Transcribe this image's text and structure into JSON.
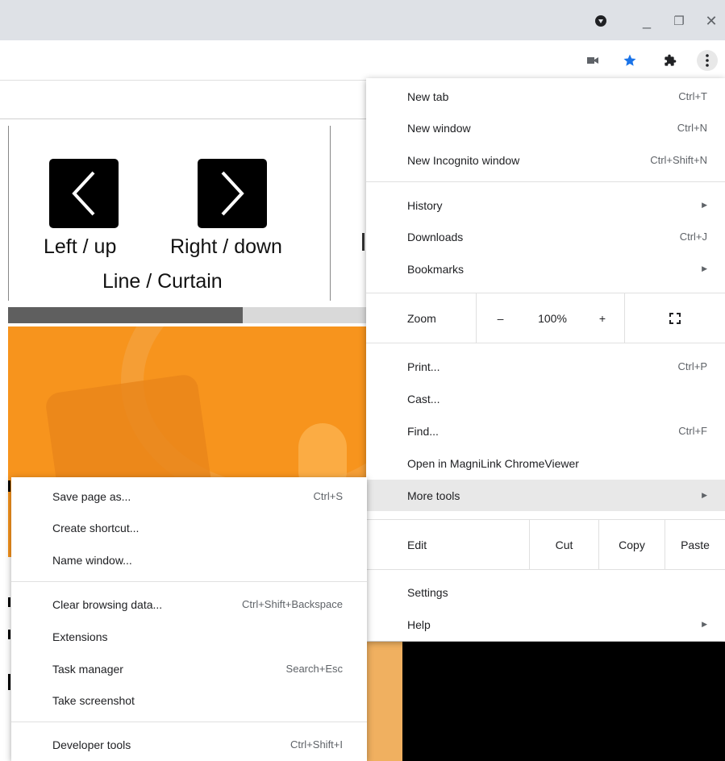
{
  "window_controls": {
    "minimize": "_",
    "restore": "❐",
    "close": "✕"
  },
  "page": {
    "left_label": "Left / up",
    "right_label": "Right / down",
    "mode_label": "Line / Curtain"
  },
  "main_menu": {
    "new_tab": {
      "label": "New tab",
      "shortcut": "Ctrl+T"
    },
    "new_window": {
      "label": "New window",
      "shortcut": "Ctrl+N"
    },
    "new_incognito": {
      "label": "New Incognito window",
      "shortcut": "Ctrl+Shift+N"
    },
    "history": {
      "label": "History"
    },
    "downloads": {
      "label": "Downloads",
      "shortcut": "Ctrl+J"
    },
    "bookmarks": {
      "label": "Bookmarks"
    },
    "zoom": {
      "label": "Zoom",
      "minus": "–",
      "value": "100%",
      "plus": "+"
    },
    "print": {
      "label": "Print...",
      "shortcut": "Ctrl+P"
    },
    "cast": {
      "label": "Cast..."
    },
    "find": {
      "label": "Find...",
      "shortcut": "Ctrl+F"
    },
    "open_magnilink": {
      "label": "Open in MagniLink ChromeViewer"
    },
    "more_tools": {
      "label": "More tools"
    },
    "edit": {
      "label": "Edit",
      "cut": "Cut",
      "copy": "Copy",
      "paste": "Paste"
    },
    "settings": {
      "label": "Settings"
    },
    "help": {
      "label": "Help"
    }
  },
  "more_tools_menu": {
    "save_page": {
      "label": "Save page as...",
      "shortcut": "Ctrl+S"
    },
    "create_shortcut": {
      "label": "Create shortcut..."
    },
    "name_window": {
      "label": "Name window..."
    },
    "clear_data": {
      "label": "Clear browsing data...",
      "shortcut": "Ctrl+Shift+Backspace"
    },
    "extensions": {
      "label": "Extensions"
    },
    "task_manager": {
      "label": "Task manager",
      "shortcut": "Search+Esc"
    },
    "take_screenshot": {
      "label": "Take screenshot"
    },
    "developer_tools": {
      "label": "Developer tools",
      "shortcut": "Ctrl+Shift+I"
    }
  },
  "colors": {
    "accent_star": "#1a73e8",
    "hero_orange": "#f7941d",
    "highlight": "#e8e8e8"
  }
}
